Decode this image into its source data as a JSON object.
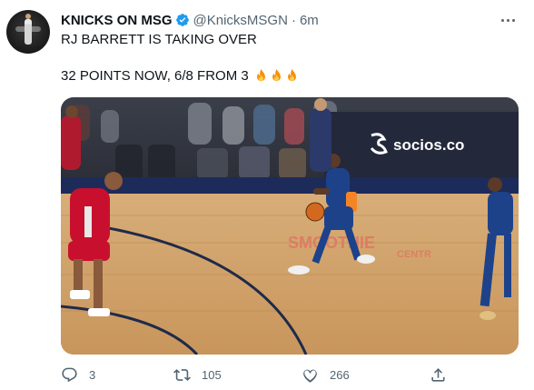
{
  "tweet": {
    "author_name": "KNICKS ON MSG",
    "handle": "@KnicksMSGN",
    "separator": "·",
    "time": "6m",
    "line1": "RJ BARRETT IS TAKING OVER",
    "line2": "32 POINTS NOW, 6/8 FROM 3",
    "emoji_count": 3
  },
  "media": {
    "sponsor_text": "socios.co",
    "court_text_1": "SMOOTHIE",
    "court_text_2": "CENTR"
  },
  "actions": {
    "reply_count": "3",
    "retweet_count": "105",
    "like_count": "266"
  },
  "colors": {
    "text_primary": "#0f1419",
    "text_secondary": "#536471",
    "verified_blue": "#1d9bf0",
    "court_wood": "#c99a62",
    "knicks_blue": "#1d428a",
    "pelicans_red": "#c8102e"
  },
  "icons": [
    "verified-badge-icon",
    "more-icon",
    "fire-emoji-icon",
    "reply-icon",
    "retweet-icon",
    "like-icon",
    "share-icon"
  ]
}
